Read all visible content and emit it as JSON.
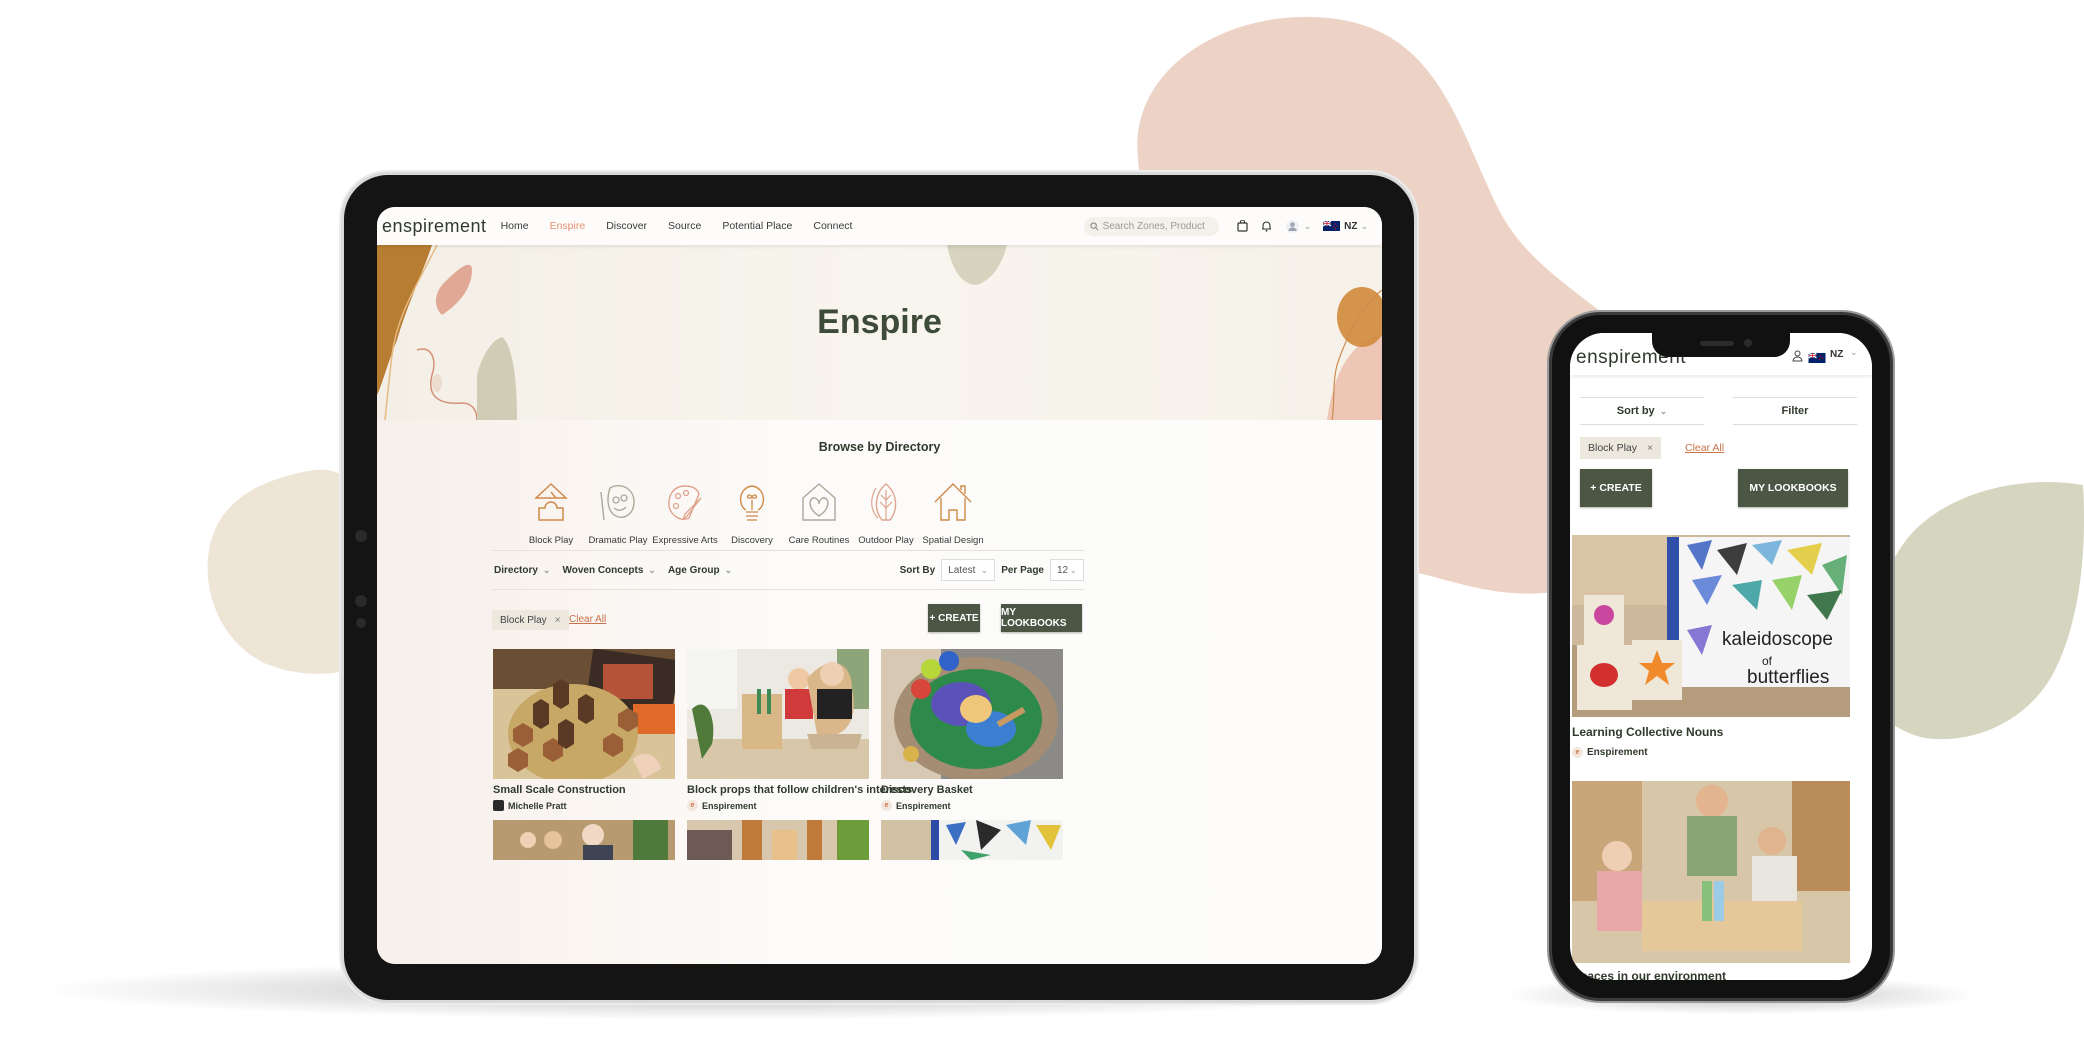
{
  "colors": {
    "brand_dark": "#4b5644",
    "accent_orange": "#c9734a",
    "active_nav": "#e0906f",
    "blob_pink": "#edd3c5",
    "blob_beige": "#efe5d7",
    "blob_sage": "#d6d5bf"
  },
  "tablet": {
    "nav": {
      "logo": "enspirement",
      "links": [
        "Home",
        "Enspire",
        "Discover",
        "Source",
        "Potential Place",
        "Connect"
      ],
      "active_link": "Enspire",
      "search_placeholder": "Search Zones, Product",
      "icons": [
        "bag-icon",
        "bell-icon",
        "user-icon",
        "nz-flag-icon"
      ],
      "region": "NZ"
    },
    "hero": {
      "title": "Enspire"
    },
    "browse": {
      "title": "Browse by Directory",
      "items": [
        {
          "label": "Block Play",
          "icon": "block-play-icon"
        },
        {
          "label": "Dramatic Play",
          "icon": "mask-icon"
        },
        {
          "label": "Expressive Arts",
          "icon": "palette-icon"
        },
        {
          "label": "Discovery",
          "icon": "lightbulb-icon"
        },
        {
          "label": "Care Routines",
          "icon": "heart-house-icon"
        },
        {
          "label": "Outdoor Play",
          "icon": "leaf-icon"
        },
        {
          "label": "Spatial Design",
          "icon": "house-icon"
        }
      ]
    },
    "filters": {
      "dropdowns": [
        "Directory",
        "Woven Concepts",
        "Age Group"
      ],
      "sort_by_label": "Sort By",
      "sort_by_value": "Latest",
      "per_page_label": "Per Page",
      "per_page_value": "12",
      "active_chip": "Block Play",
      "clear_all": "Clear All",
      "create_button": "+ CREATE",
      "lookbooks_button": "MY LOOKBOOKS"
    },
    "cards": [
      {
        "title": "Small Scale Construction",
        "author": "Michelle Pratt"
      },
      {
        "title": "Block props that follow children's interests",
        "author": "Enspirement"
      },
      {
        "title": "Discovery Basket",
        "author": "Enspirement"
      }
    ]
  },
  "phone": {
    "nav": {
      "logo": "enspirement",
      "region": "NZ"
    },
    "sort_by": "Sort by",
    "filter": "Filter",
    "active_chip": "Block Play",
    "clear_all": "Clear All",
    "create_button": "+ CREATE",
    "lookbooks_button": "MY LOOKBOOKS",
    "cards": [
      {
        "title": "Learning Collective Nouns",
        "author": "Enspirement",
        "image_text": "a kaleidoscope of butterflies"
      },
      {
        "title": "Spaces in our environment",
        "author": ""
      }
    ]
  }
}
